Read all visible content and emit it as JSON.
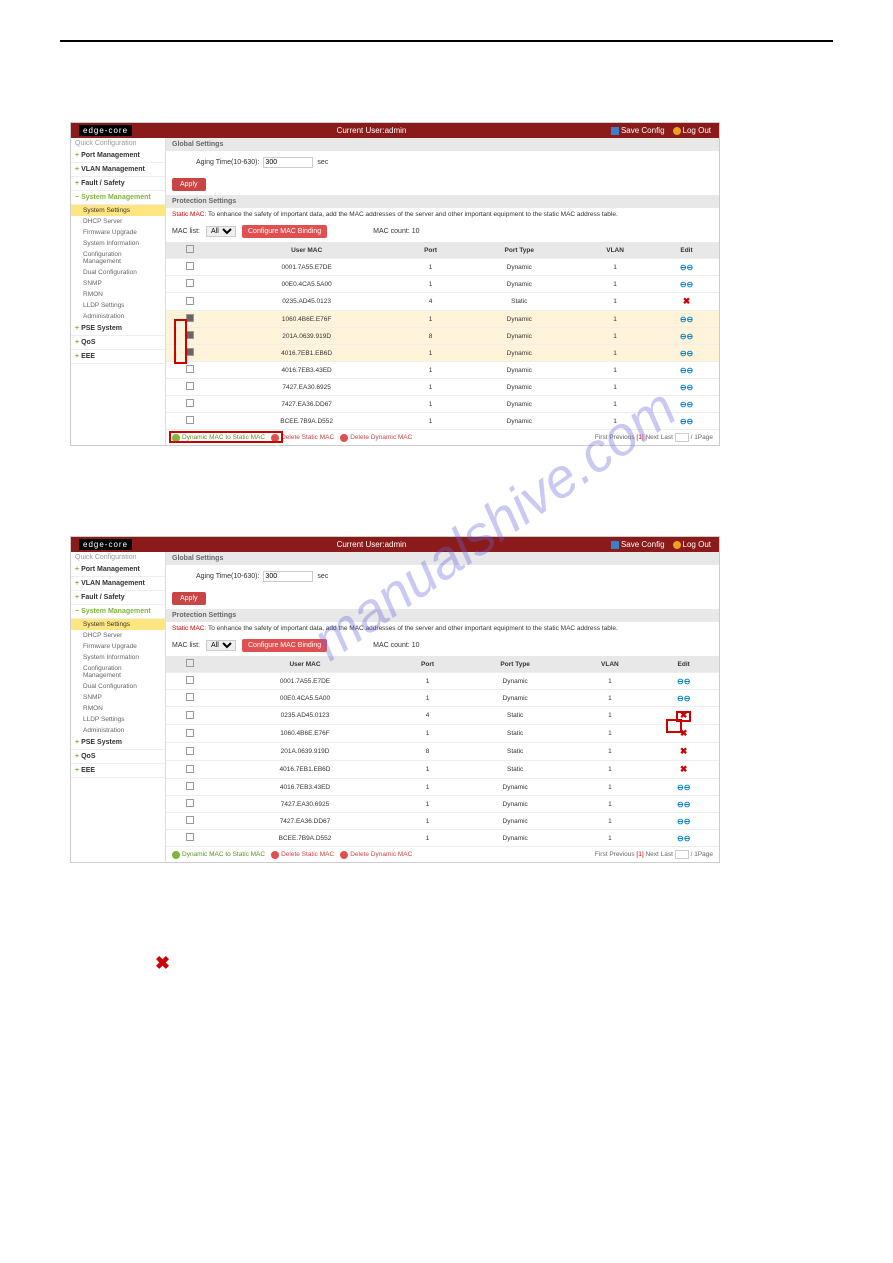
{
  "header": {
    "logo": "edge-core",
    "currentUser": "Current User:admin",
    "saveConfig": "Save Config",
    "logOut": "Log Out"
  },
  "sidebar": {
    "quick": "Quick Configuration",
    "items": [
      {
        "label": "Port Management",
        "expand": "+"
      },
      {
        "label": "VLAN Management",
        "expand": "+"
      },
      {
        "label": "Fault / Safety",
        "expand": "+"
      },
      {
        "label": "System Management",
        "expand": "-",
        "active": true,
        "subs": [
          {
            "label": "System Settings",
            "active": true
          },
          {
            "label": "DHCP Server"
          },
          {
            "label": "Firmware Upgrade"
          },
          {
            "label": "System Information"
          },
          {
            "label": "Configuration Management"
          },
          {
            "label": "Dual Configuration"
          },
          {
            "label": "SNMP"
          },
          {
            "label": "RMON"
          },
          {
            "label": "LLDP Settings"
          },
          {
            "label": "Administration"
          }
        ]
      },
      {
        "label": "PSE System",
        "expand": "+"
      },
      {
        "label": "QoS",
        "expand": "+"
      },
      {
        "label": "EEE",
        "expand": "+"
      }
    ]
  },
  "main": {
    "globalSettings": "Global Settings",
    "agingLabel": "Aging Time(10-630):",
    "agingValue": "300",
    "sec": "sec",
    "apply": "Apply",
    "protection": "Protection Settings",
    "staticNote": "Static MAC:",
    "staticDesc": "To enhance the safety of important data, add the MAC addresses of the server and other important equipment to the static MAC address table.",
    "macList": "MAC list:",
    "macListAll": "All",
    "cfgBinding": "Configure MAC Binding",
    "macCountLbl": "MAC count:",
    "macCount": "10",
    "col": {
      "usermac": "User MAC",
      "port": "Port",
      "porttype": "Port Type",
      "vlan": "VLAN",
      "edit": "Edit"
    },
    "actionsRow": {
      "dyn2stat": "Dynamic MAC to Static MAC",
      "delStatic": "Delete Static MAC",
      "delDynamic": "Delete Dynamic MAC"
    },
    "pager": {
      "first": "First",
      "prev": "Previous",
      "cur": "[1]",
      "next": "Next",
      "last": "Last",
      "perPage": "/ 1Page"
    }
  },
  "rows1": [
    {
      "mac": "0001.7A55.E7DE",
      "port": "1",
      "type": "Dynamic",
      "vlan": "1",
      "edit": "link"
    },
    {
      "mac": "00E0.4CA5.5A00",
      "port": "1",
      "type": "Dynamic",
      "vlan": "1",
      "edit": "link"
    },
    {
      "mac": "0235.AD45.0123",
      "port": "4",
      "type": "Static",
      "vlan": "1",
      "edit": "del"
    },
    {
      "mac": "1060.4B6E.E76F",
      "port": "1",
      "type": "Dynamic",
      "vlan": "1",
      "edit": "link",
      "sel": true
    },
    {
      "mac": "201A.0639.919D",
      "port": "8",
      "type": "Dynamic",
      "vlan": "1",
      "edit": "link",
      "sel": true
    },
    {
      "mac": "4016.7EB1.EB6D",
      "port": "1",
      "type": "Dynamic",
      "vlan": "1",
      "edit": "link",
      "sel": true
    },
    {
      "mac": "4016.7EB3.43ED",
      "port": "1",
      "type": "Dynamic",
      "vlan": "1",
      "edit": "link"
    },
    {
      "mac": "7427.EA30.6925",
      "port": "1",
      "type": "Dynamic",
      "vlan": "1",
      "edit": "link"
    },
    {
      "mac": "7427.EA36.DD67",
      "port": "1",
      "type": "Dynamic",
      "vlan": "1",
      "edit": "link"
    },
    {
      "mac": "BCEE.7B9A.D552",
      "port": "1",
      "type": "Dynamic",
      "vlan": "1",
      "edit": "link"
    }
  ],
  "rows2": [
    {
      "mac": "0001.7A55.E7DE",
      "port": "1",
      "type": "Dynamic",
      "vlan": "1",
      "edit": "link"
    },
    {
      "mac": "00E0.4CA5.5A00",
      "port": "1",
      "type": "Dynamic",
      "vlan": "1",
      "edit": "link"
    },
    {
      "mac": "0235.AD45.0123",
      "port": "4",
      "type": "Static",
      "vlan": "1",
      "edit": "del",
      "hl": true
    },
    {
      "mac": "1060.4B6E.E76F",
      "port": "1",
      "type": "Static",
      "vlan": "1",
      "edit": "del"
    },
    {
      "mac": "201A.0639.919D",
      "port": "8",
      "type": "Static",
      "vlan": "1",
      "edit": "del"
    },
    {
      "mac": "4016.7EB1.EB6D",
      "port": "1",
      "type": "Static",
      "vlan": "1",
      "edit": "del"
    },
    {
      "mac": "4016.7EB3.43ED",
      "port": "1",
      "type": "Dynamic",
      "vlan": "1",
      "edit": "link"
    },
    {
      "mac": "7427.EA30.6925",
      "port": "1",
      "type": "Dynamic",
      "vlan": "1",
      "edit": "link"
    },
    {
      "mac": "7427.EA36.DD67",
      "port": "1",
      "type": "Dynamic",
      "vlan": "1",
      "edit": "link"
    },
    {
      "mac": "BCEE.7B9A.D552",
      "port": "1",
      "type": "Dynamic",
      "vlan": "1",
      "edit": "link"
    }
  ]
}
